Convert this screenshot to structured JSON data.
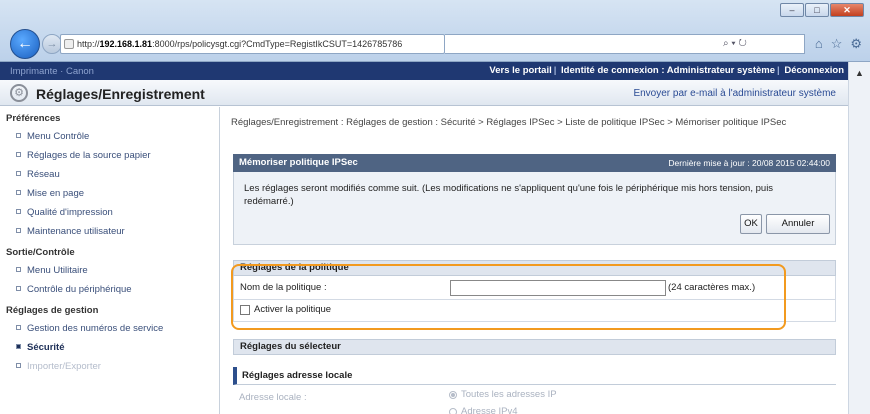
{
  "browser": {
    "url_host": "192.168.1.81",
    "url_rest": ":8000/rps/policysgt.cgi?CmdType=RegistIkCSUT=1426785786",
    "search_glyph": "⌕ ▾ ↻",
    "window_min": "–",
    "window_max": "□",
    "window_close": "✕"
  },
  "top_header": {
    "device_name": "Imprimante · Canon",
    "links": [
      "Vers le portail",
      "Identité de connexion : Administrateur système",
      "Déconnexion"
    ]
  },
  "title_bar": {
    "title": "Réglages/Enregistrement",
    "mail_link": "Envoyer par e-mail à l'administrateur système"
  },
  "sidebar": {
    "sections": [
      {
        "label": "Préférences",
        "items": [
          "Menu Contrôle",
          "Réglages de la source papier",
          "Réseau",
          "Mise en page",
          "Qualité d'impression",
          "Maintenance utilisateur"
        ]
      },
      {
        "label": "Sortie/Contrôle",
        "items": [
          "Menu Utilitaire",
          "Contrôle du périphérique"
        ]
      },
      {
        "label": "Réglages de gestion",
        "items": [
          "Gestion des numéros de service",
          "Sécurité",
          "Importer/Exporter"
        ]
      }
    ]
  },
  "main": {
    "breadcrumb": "Réglages/Enregistrement : Réglages de gestion : Sécurité > Réglages IPSec > Liste de politique IPSec > Mémoriser politique IPSec",
    "panel_title": "Mémoriser politique IPSec",
    "last_update": "Dernière mise à jour : 20/08 2015 02:44:00",
    "message": "Les réglages seront modifiés comme suit. (Les modifications ne s'appliquent qu'une fois le périphérique mis hors tension, puis redémarré.)",
    "ok_label": "OK",
    "cancel_label": "Annuler",
    "policy_section": "Réglages de la politique",
    "policy_name_label": "Nom de la politique :",
    "policy_name_value": "",
    "policy_name_hint": "(24 caractères max.)",
    "enable_policy_label": "Activer la politique",
    "selector_section": "Réglages du sélecteur",
    "local_address_section": "Réglages adresse locale",
    "local_address_label": "Adresse locale :",
    "local_address_options": [
      "Toutes les adresses IP",
      "Adresse IPv4"
    ]
  }
}
